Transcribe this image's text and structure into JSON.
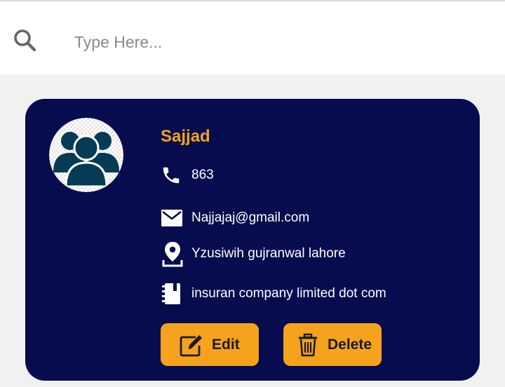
{
  "search": {
    "placeholder": "Type Here...",
    "icon": "search-icon"
  },
  "contact": {
    "name": "Sajjad",
    "phone": "863",
    "email": "Najjajaj@gmail.com",
    "address": "Yzusiwih gujranwal lahore",
    "company": "insuran company limited dot com"
  },
  "actions": {
    "edit_label": "Edit",
    "delete_label": "Delete"
  },
  "colors": {
    "card_bg": "#060c4e",
    "accent": "#f5a21c",
    "avatar_fg": "#063a55",
    "page_bg": "#f1f1f1"
  }
}
